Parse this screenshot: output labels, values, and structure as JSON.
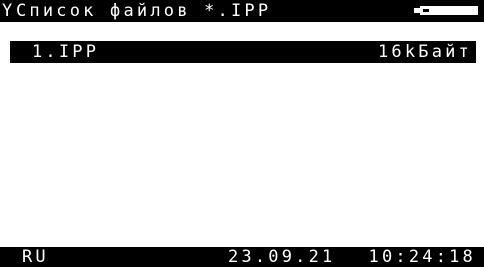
{
  "titlebar": {
    "icon": "list-icon",
    "icon_glyph": "Y",
    "title": "Список файлов *.IPP",
    "battery_level": 0.12
  },
  "file_list": {
    "items": [
      {
        "name": "1.IPP",
        "size": "16kБайт",
        "selected": true
      }
    ]
  },
  "statusbar": {
    "language": "RU",
    "date": "23.09.21",
    "time": "10:24:18"
  },
  "colors": {
    "background": "#ffffff",
    "bar": "#000000",
    "bar_text": "#ffffff"
  }
}
